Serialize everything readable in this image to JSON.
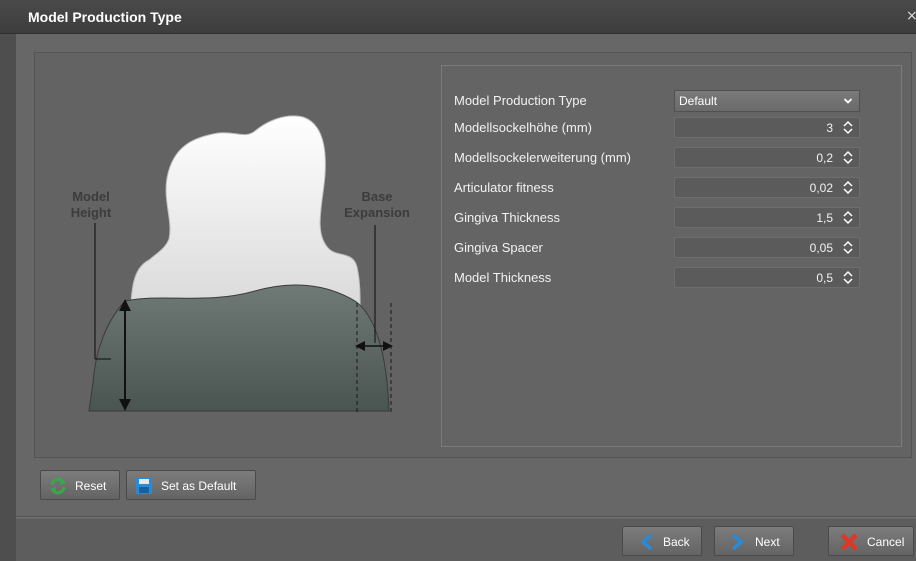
{
  "window": {
    "title": "Model Production Type",
    "close_glyph": "×"
  },
  "preview": {
    "label_model": "Model",
    "label_height": "Height",
    "label_base": "Base",
    "label_expansion": "Expansion"
  },
  "settings": {
    "rows": [
      {
        "label": "Model Production Type",
        "value": "Default",
        "kind": "select"
      },
      {
        "label": "Modellsockelhöhe (mm)",
        "value": "3",
        "kind": "spin"
      },
      {
        "label": "Modellsockelerweiterung (mm)",
        "value": "0,2",
        "kind": "spin"
      },
      {
        "label": "Articulator fitness",
        "value": "0,02",
        "kind": "spin"
      },
      {
        "label": "Gingiva Thickness",
        "value": "1,5",
        "kind": "spin"
      },
      {
        "label": "Gingiva Spacer",
        "value": "0,05",
        "kind": "spin"
      },
      {
        "label": "Model Thickness",
        "value": "0,5",
        "kind": "spin"
      }
    ]
  },
  "buttons": {
    "reset": "Reset",
    "set_default": "Set as Default",
    "back": "Back",
    "next": "Next",
    "cancel": "Cancel"
  },
  "colors": {
    "accent_blue": "#2a8ad6",
    "reset_green": "#3aa84a",
    "cancel_red": "#d63a2a"
  }
}
